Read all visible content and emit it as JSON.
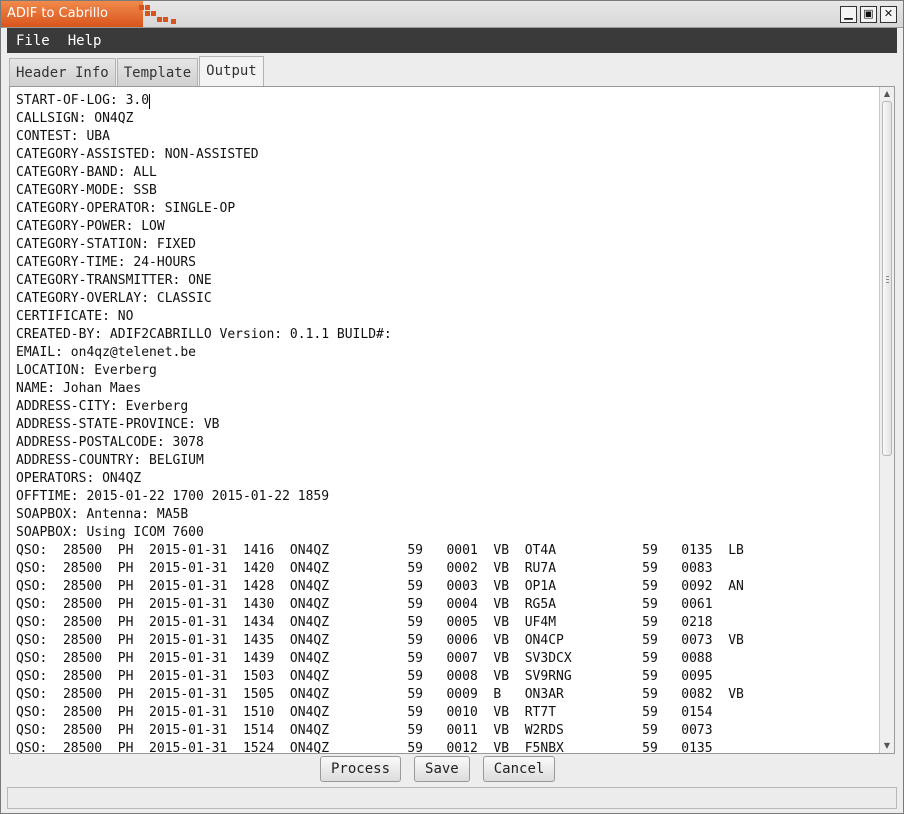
{
  "window": {
    "title": "ADIF to Cabrillo"
  },
  "menu": [
    "File",
    "Help"
  ],
  "tabs": [
    "Header Info",
    "Template",
    "Output"
  ],
  "active_tab": "Output",
  "output_lines": [
    "START-OF-LOG: 3.0",
    "CALLSIGN: ON4QZ",
    "CONTEST: UBA",
    "CATEGORY-ASSISTED: NON-ASSISTED",
    "CATEGORY-BAND: ALL",
    "CATEGORY-MODE: SSB",
    "CATEGORY-OPERATOR: SINGLE-OP",
    "CATEGORY-POWER: LOW",
    "CATEGORY-STATION: FIXED",
    "CATEGORY-TIME: 24-HOURS",
    "CATEGORY-TRANSMITTER: ONE",
    "CATEGORY-OVERLAY: CLASSIC",
    "CERTIFICATE: NO",
    "CREATED-BY: ADIF2CABRILLO Version: 0.1.1 BUILD#:",
    "EMAIL: on4qz@telenet.be",
    "LOCATION: Everberg",
    "NAME: Johan Maes",
    "ADDRESS-CITY: Everberg",
    "ADDRESS-STATE-PROVINCE: VB",
    "ADDRESS-POSTALCODE: 3078",
    "ADDRESS-COUNTRY: BELGIUM",
    "OPERATORS: ON4QZ",
    "OFFTIME: 2015-01-22 1700 2015-01-22 1859",
    "SOAPBOX: Antenna: MA5B",
    "SOAPBOX: Using ICOM 7600",
    "QSO:  28500  PH  2015-01-31  1416  ON4QZ          59   0001  VB  OT4A           59   0135  LB",
    "QSO:  28500  PH  2015-01-31  1420  ON4QZ          59   0002  VB  RU7A           59   0083",
    "QSO:  28500  PH  2015-01-31  1428  ON4QZ          59   0003  VB  OP1A           59   0092  AN",
    "QSO:  28500  PH  2015-01-31  1430  ON4QZ          59   0004  VB  RG5A           59   0061",
    "QSO:  28500  PH  2015-01-31  1434  ON4QZ          59   0005  VB  UF4M           59   0218",
    "QSO:  28500  PH  2015-01-31  1435  ON4QZ          59   0006  VB  ON4CP          59   0073  VB",
    "QSO:  28500  PH  2015-01-31  1439  ON4QZ          59   0007  VB  SV3DCX         59   0088",
    "QSO:  28500  PH  2015-01-31  1503  ON4QZ          59   0008  VB  SV9RNG         59   0095",
    "QSO:  28500  PH  2015-01-31  1505  ON4QZ          59   0009  B   ON3AR          59   0082  VB",
    "QSO:  28500  PH  2015-01-31  1510  ON4QZ          59   0010  VB  RT7T           59   0154",
    "QSO:  28500  PH  2015-01-31  1514  ON4QZ          59   0011  VB  W2RDS          59   0073",
    "QSO:  28500  PH  2015-01-31  1524  ON4QZ          59   0012  VB  F5NBX          59   0135"
  ],
  "buttons": {
    "process": "Process",
    "save": "Save",
    "cancel": "Cancel"
  }
}
